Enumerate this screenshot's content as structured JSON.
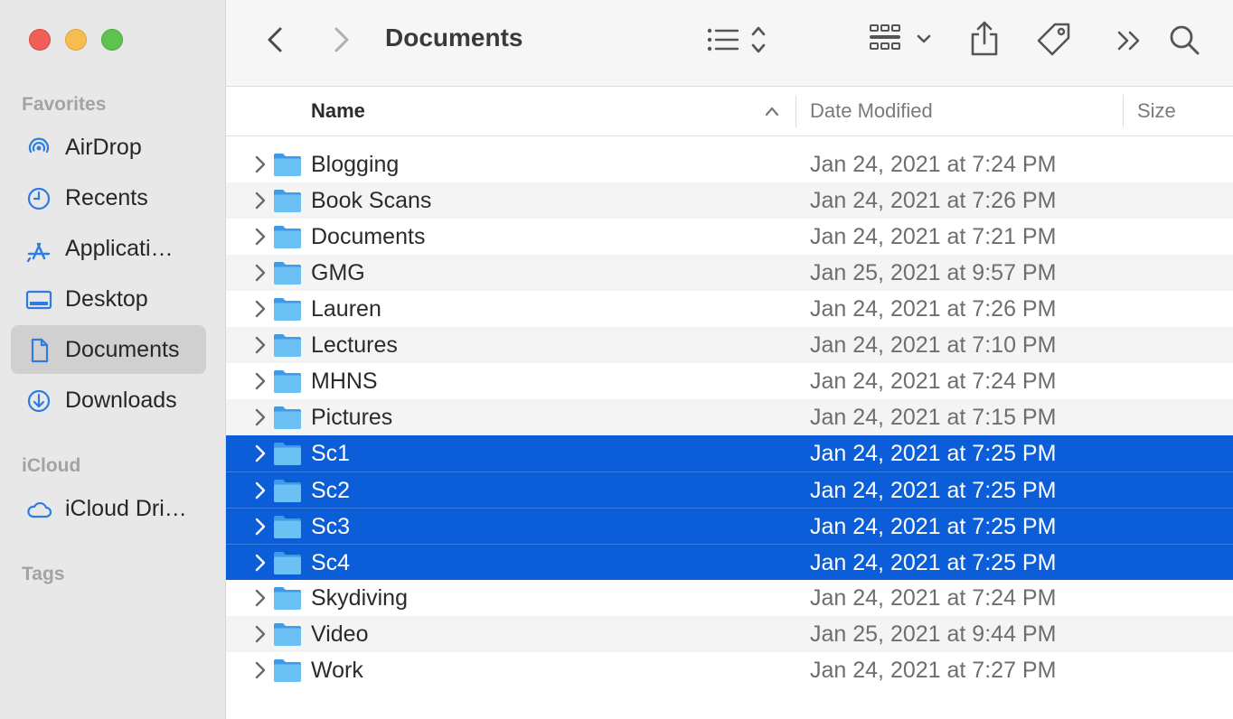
{
  "window": {
    "title": "Documents"
  },
  "sidebar": {
    "sections": [
      {
        "title": "Favorites",
        "items": [
          {
            "label": "AirDrop",
            "icon": "airdrop-icon"
          },
          {
            "label": "Recents",
            "icon": "clock-icon"
          },
          {
            "label": "Applicati…",
            "icon": "applications-icon"
          },
          {
            "label": "Desktop",
            "icon": "desktop-icon"
          },
          {
            "label": "Documents",
            "icon": "document-icon",
            "selected": true
          },
          {
            "label": "Downloads",
            "icon": "download-icon"
          }
        ]
      },
      {
        "title": "iCloud",
        "items": [
          {
            "label": "iCloud Dri…",
            "icon": "cloud-icon"
          }
        ]
      },
      {
        "title": "Tags",
        "items": []
      }
    ]
  },
  "toolbar": {
    "icons": [
      "back-icon",
      "forward-icon",
      "list-view-icon",
      "group-icon",
      "share-icon",
      "tag-icon",
      "more-icon",
      "search-icon"
    ]
  },
  "columns": {
    "name": "Name",
    "date": "Date Modified",
    "size": "Size"
  },
  "files": [
    {
      "name": "Blogging",
      "date": "Jan 24, 2021 at 7:24 PM",
      "selected": false
    },
    {
      "name": "Book Scans",
      "date": "Jan 24, 2021 at 7:26 PM",
      "selected": false
    },
    {
      "name": "Documents",
      "date": "Jan 24, 2021 at 7:21 PM",
      "selected": false
    },
    {
      "name": "GMG",
      "date": "Jan 25, 2021 at 9:57 PM",
      "selected": false
    },
    {
      "name": "Lauren",
      "date": "Jan 24, 2021 at 7:26 PM",
      "selected": false
    },
    {
      "name": "Lectures",
      "date": "Jan 24, 2021 at 7:10 PM",
      "selected": false
    },
    {
      "name": "MHNS",
      "date": "Jan 24, 2021 at 7:24 PM",
      "selected": false
    },
    {
      "name": "Pictures",
      "date": "Jan 24, 2021 at 7:15 PM",
      "selected": false
    },
    {
      "name": "Sc1",
      "date": "Jan 24, 2021 at 7:25 PM",
      "selected": true
    },
    {
      "name": "Sc2",
      "date": "Jan 24, 2021 at 7:25 PM",
      "selected": true
    },
    {
      "name": "Sc3",
      "date": "Jan 24, 2021 at 7:25 PM",
      "selected": true
    },
    {
      "name": "Sc4",
      "date": "Jan 24, 2021 at 7:25 PM",
      "selected": true
    },
    {
      "name": "Skydiving",
      "date": "Jan 24, 2021 at 7:24 PM",
      "selected": false
    },
    {
      "name": "Video",
      "date": "Jan 25, 2021 at 9:44 PM",
      "selected": false
    },
    {
      "name": "Work",
      "date": "Jan 24, 2021 at 7:27 PM",
      "selected": false
    }
  ],
  "colors": {
    "accent": "#0b5ed7",
    "sidebar_icon": "#2f7be0",
    "folder": "#5ab3ee"
  }
}
